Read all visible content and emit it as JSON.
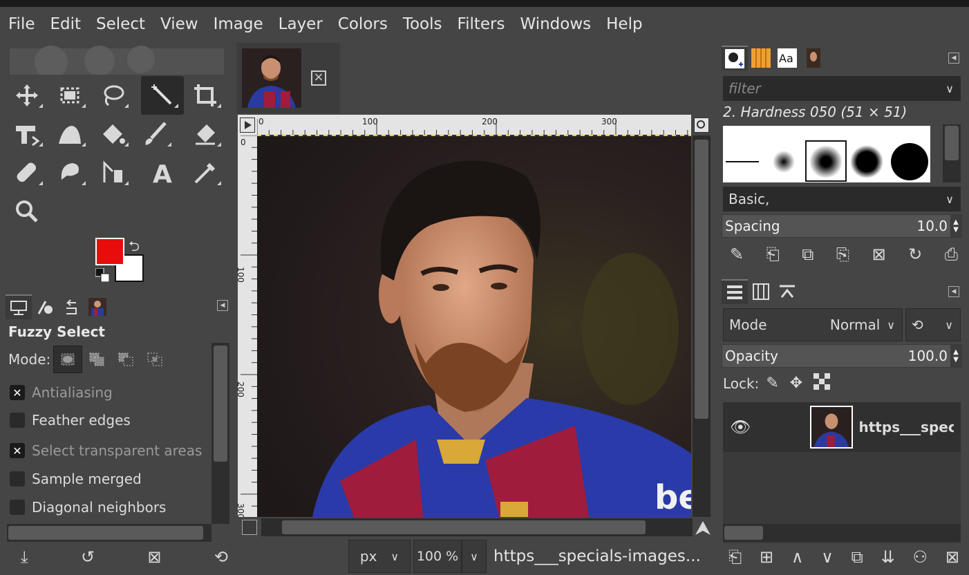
{
  "menubar": {
    "items": [
      "File",
      "Edit",
      "Select",
      "View",
      "Image",
      "Layer",
      "Colors",
      "Tools",
      "Filters",
      "Windows",
      "Help"
    ]
  },
  "colors": {
    "foreground": "#e80c0c",
    "background": "#ffffff",
    "accent": "#e8d800"
  },
  "tool_options": {
    "title": "Fuzzy Select",
    "mode_label": "Mode:",
    "options": [
      {
        "label": "Antialiasing",
        "checked": true
      },
      {
        "label": "Feather edges",
        "checked": false
      },
      {
        "label": "Select transparent areas",
        "checked": true
      },
      {
        "label": "Sample merged",
        "checked": false
      },
      {
        "label": "Diagonal neighbors",
        "checked": false
      }
    ]
  },
  "ruler": {
    "h_labels": [
      "0",
      "100",
      "200",
      "300"
    ],
    "v_labels": [
      "0",
      "100",
      "200",
      "300"
    ]
  },
  "status": {
    "unit": "px",
    "zoom": "100 %",
    "title": "https___specials-images..."
  },
  "brushes": {
    "filter_placeholder": "filter",
    "selected_brush": "2. Hardness 050 (51 × 51)",
    "tag": "Basic,",
    "spacing_label": "Spacing",
    "spacing_value": "10.0"
  },
  "layers": {
    "mode_label": "Mode",
    "mode_value": "Normal",
    "opacity_label": "Opacity",
    "opacity_value": "100.0",
    "lock_label": "Lock:",
    "layer_name": "https___speci:"
  }
}
